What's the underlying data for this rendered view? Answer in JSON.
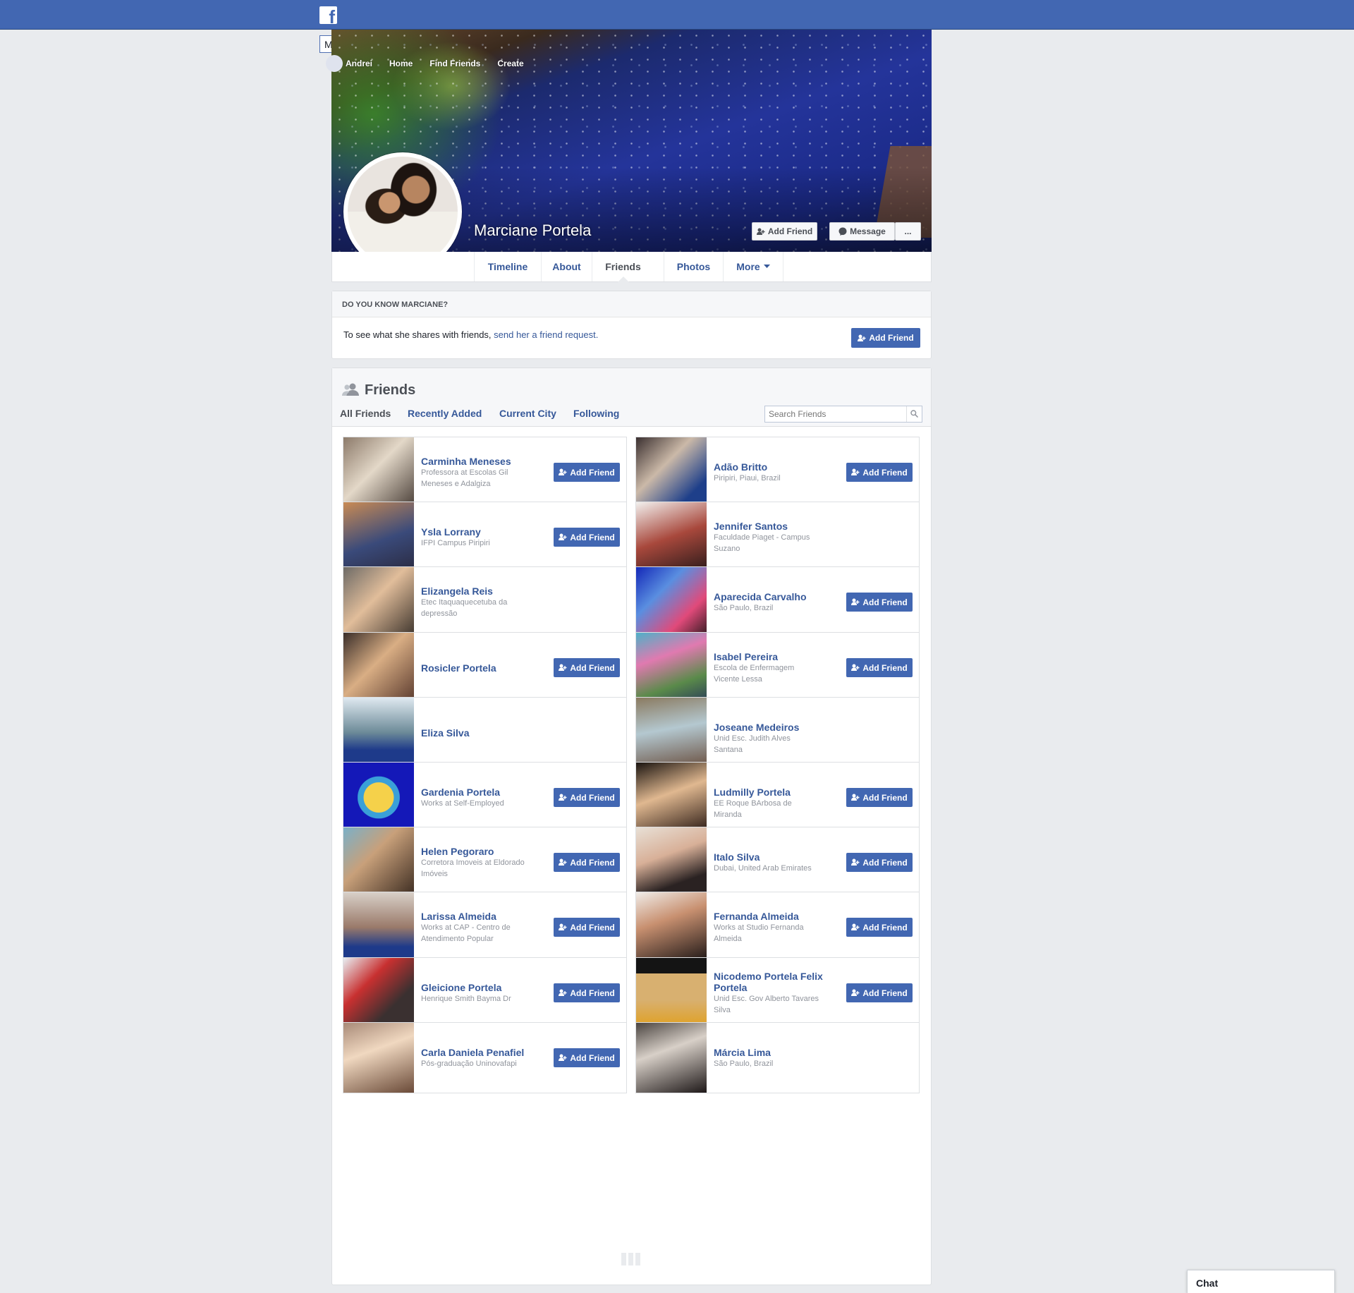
{
  "search": {
    "value": "Marciane Portela"
  },
  "topnav": {
    "user": "Andrei",
    "home": "Home",
    "find_friends": "Find Friends",
    "create": "Create"
  },
  "profile": {
    "name": "Marciane Portela",
    "add_friend": "Add Friend",
    "message": "Message",
    "more_dots": "..."
  },
  "tabs": {
    "timeline": "Timeline",
    "about": "About",
    "friends": "Friends",
    "photos": "Photos",
    "more": "More"
  },
  "know": {
    "heading": "DO YOU KNOW MARCIANE?",
    "text_pre": "To see what she shares with friends, ",
    "link": "send her a friend request.",
    "button": "Add Friend"
  },
  "friends_section": {
    "title": "Friends",
    "subtabs": [
      "All Friends",
      "Recently Added",
      "Current City",
      "Following"
    ],
    "search_placeholder": "Search Friends",
    "button_label": "Add Friend",
    "items": [
      {
        "name": "Carminha Meneses",
        "sub": "Professora at Escolas Gil Meneses e Adalgiza",
        "add": true
      },
      {
        "name": "Adão Britto",
        "sub": "Piripiri, Piaui, Brazil",
        "add": true
      },
      {
        "name": "Ysla Lorrany",
        "sub": "IFPI Campus Piripiri",
        "add": true
      },
      {
        "name": "Jennifer Santos",
        "sub": "Faculdade Piaget - Campus Suzano",
        "add": false
      },
      {
        "name": "Elizangela Reis",
        "sub": "Etec Itaquaquecetuba da depressão",
        "add": false
      },
      {
        "name": "Aparecida Carvalho",
        "sub": "São Paulo, Brazil",
        "add": true
      },
      {
        "name": "Rosicler Portela",
        "sub": "",
        "add": true
      },
      {
        "name": "Isabel Pereira",
        "sub": "Escola de Enfermagem Vicente Lessa",
        "add": true
      },
      {
        "name": "Eliza Silva",
        "sub": "",
        "add": false
      },
      {
        "name": "Joseane Medeiros",
        "sub": "Unid Esc. Judith Alves Santana",
        "add": false
      },
      {
        "name": "Gardenia Portela",
        "sub": "Works at Self-Employed",
        "add": true
      },
      {
        "name": "Ludmilly Portela",
        "sub": "EE Roque BArbosa de Miranda",
        "add": true
      },
      {
        "name": "Helen Pegoraro",
        "sub": "Corretora Imoveis at Eldorado Imóveis",
        "add": true
      },
      {
        "name": "Italo Silva",
        "sub": "Dubai, United Arab Emirates",
        "add": true
      },
      {
        "name": "Larissa Almeida",
        "sub": "Works at CAP - Centro de Atendimento Popular",
        "add": true
      },
      {
        "name": "Fernanda Almeida",
        "sub": "Works at Studio Fernanda Almeida",
        "add": true
      },
      {
        "name": "Gleicione Portela",
        "sub": "Henrique Smith Bayma Dr",
        "add": true
      },
      {
        "name": "Nicodemo Portela Felix Portela",
        "sub": "Unid Esc. Gov Alberto Tavares Silva",
        "add": true
      },
      {
        "name": "Carla Daniela Penafiel",
        "sub": "Pós-graduação Uninovafapi",
        "add": true
      },
      {
        "name": "Márcia Lima",
        "sub": "São Paulo, Brazil",
        "add": false
      }
    ]
  },
  "chat": {
    "label": "Chat"
  },
  "colors": {
    "brand": "#4267b2",
    "link": "#365899",
    "page_bg": "#e9ebee"
  }
}
